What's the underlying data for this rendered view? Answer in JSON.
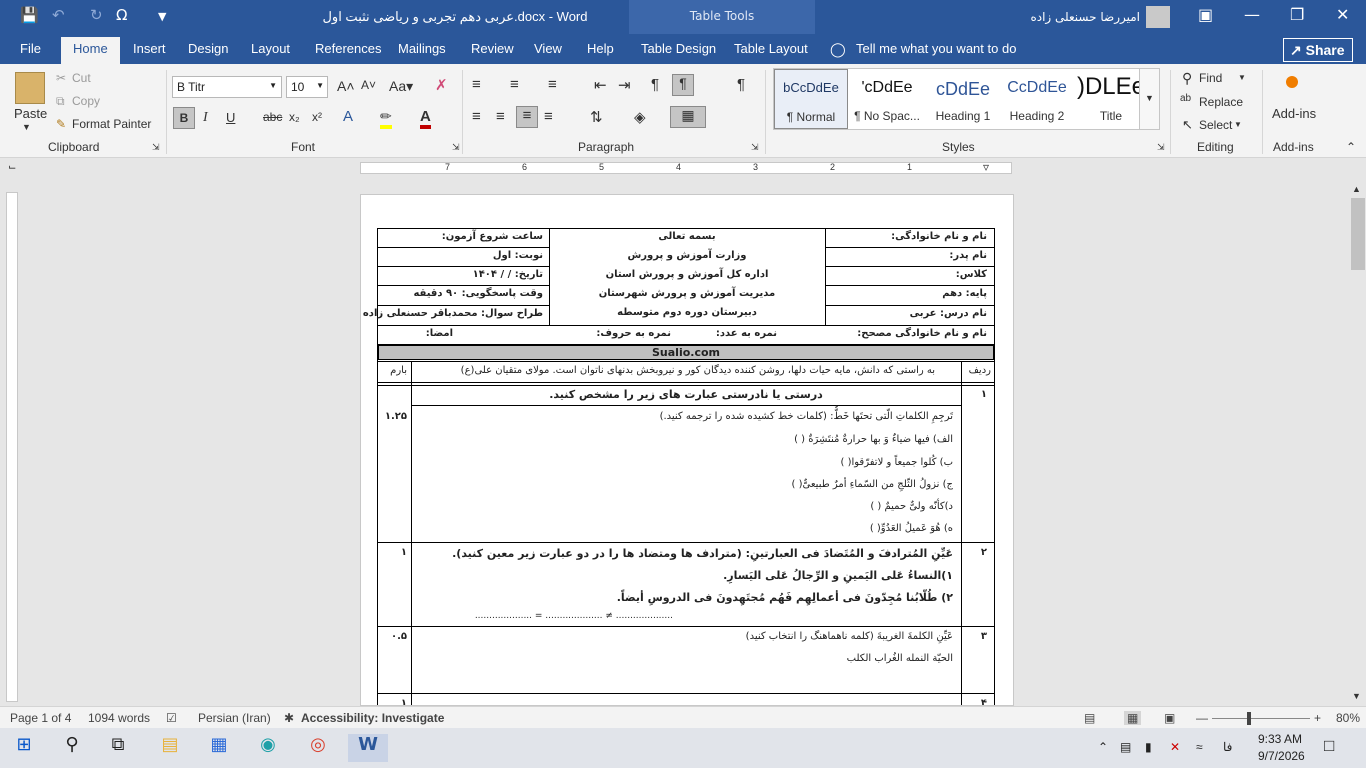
{
  "window": {
    "doc_title": "عربی دهم تجربی و ریاضی نثبت اول.docx  -  Word",
    "table_tools": "Table Tools",
    "user_name": "امیررضا حسنعلی زاده"
  },
  "tabs": [
    "File",
    "Home",
    "Insert",
    "Design",
    "Layout",
    "References",
    "Mailings",
    "Review",
    "View",
    "Help",
    "Table Design",
    "Table Layout"
  ],
  "tell_me": "Tell me what you want to do",
  "share": "Share",
  "ribbon": {
    "clipboard": {
      "label": "Clipboard",
      "paste": "Paste",
      "cut": "Cut",
      "copy": "Copy",
      "format_painter": "Format Painter"
    },
    "font": {
      "label": "Font",
      "name": "B Titr",
      "size": "10"
    },
    "paragraph": {
      "label": "Paragraph"
    },
    "styles": {
      "label": "Styles",
      "items": [
        {
          "preview": "bCcDdEe",
          "name": "¶ Normal"
        },
        {
          "preview": "'cDdEe",
          "name": "¶ No Spac..."
        },
        {
          "preview": "cDdEe",
          "name": "Heading 1"
        },
        {
          "preview": "CcDdEe",
          "name": "Heading 2"
        },
        {
          "preview": ")DLEe",
          "name": "Title"
        }
      ]
    },
    "editing": {
      "label": "Editing",
      "find": "Find",
      "replace": "Replace",
      "select": "Select"
    },
    "addins": {
      "label": "Add-ins",
      "button": "Add-ins"
    }
  },
  "ruler_numbers": [
    "7",
    "6",
    "5",
    "4",
    "3",
    "2",
    "1"
  ],
  "exam": {
    "left_col": [
      "نام و نام خانوادگی:",
      "نام پدر:",
      "کلاس:",
      "پایه: دهم",
      "نام درس: عربی"
    ],
    "center_col": [
      "بسمه تعالی",
      "وزارت آموزش و پرورش",
      "اداره کل آموزش و پرورش استان",
      "مدیریت آموزش و پرورش شهرستان",
      "دبیرستان دوره دوم متوسطه"
    ],
    "right_col": [
      "ساعت شروع آزمون:",
      "نوبت: اول",
      "تاریخ:   /   /  ۱۴۰۴",
      "وقت پاسخگویی: ۹۰ دقیقه",
      "طراح سوال: محمدباقر حسنعلی زاده"
    ],
    "grader_row": {
      "name": "نام و نام خانوادگی مصحح:",
      "score_num": "نمره به عدد:",
      "score_text": "نمره به حروف:",
      "sign": "امضا:"
    },
    "site": "Sualio.com",
    "head_row": {
      "radif": "ردیف",
      "quote": "به راستی که دانش، مایه حیات دلها، روشن کننده دیدگان کور و نیروبخش بدنهای ناتوان است. مولای متقیان علی(ع)",
      "barem": "بارم"
    },
    "q1": {
      "num": "۱",
      "title": "درستی یا نادرستی عبارت های زیر را مشخص کنید.",
      "score": "۱.۲۵",
      "lines": [
        "تَرجِمِ الکلماتِ الّتی تحتَها خَطٌّ: (کلمات خط کشیده شده را ترجمه کنید.)",
        "الف) فیها ضیاءٌ وَ بها حرارةٌ مُنتَشِرَةٌ  (                    )",
        "ب) کُلوا جمیعاً و لاتفرّقوا(                    )",
        "ج) نزولُ الثّلجِ من السّماءِ أمرٌ طبیعیٌّ(                    )",
        "د)کأنّه ولیٌّ حمیمٌ  (                    )",
        "ه) هُوَ عَمیلُ العَدُوِّ(                    )"
      ]
    },
    "q2": {
      "num": "۲",
      "score": "۱",
      "lines": [
        "عَیِّنِ المُترادفَ و المُتَضادَ فی العبارتینِ: (مترادف ها ومتضاد ها را در دو عبارت زیر معین کنید).",
        "۱)النساءُ عَلی الیَمینِ و الرِّجالُ عَلی الیَسارِ.",
        "۲) طُلّابُنا مُجِدّونَ فی أعمالِهِم فَهُم مُجتَهِدونَ فی الدروسِ أیضاً.",
        ".................... = ....................          ≠ ...................."
      ]
    },
    "q3": {
      "num": "۳",
      "score": "۰.۵",
      "lines": [
        "عَیِّنِ الکلمةَ الغریبةَ (کلمه ناهماهنگ را انتخاب کنید)",
        "الحیّة        النمله        الغُراب        الکلب"
      ]
    },
    "q4": {
      "num": "۴",
      "score": "۱"
    }
  },
  "status": {
    "page": "Page 1 of 4",
    "words": "1094 words",
    "language": "Persian (Iran)",
    "accessibility": "Accessibility: Investigate",
    "zoom": "80%"
  },
  "taskbar": {
    "time": "9:33 AM",
    "date": "9/7/2026",
    "lang": "فا"
  }
}
